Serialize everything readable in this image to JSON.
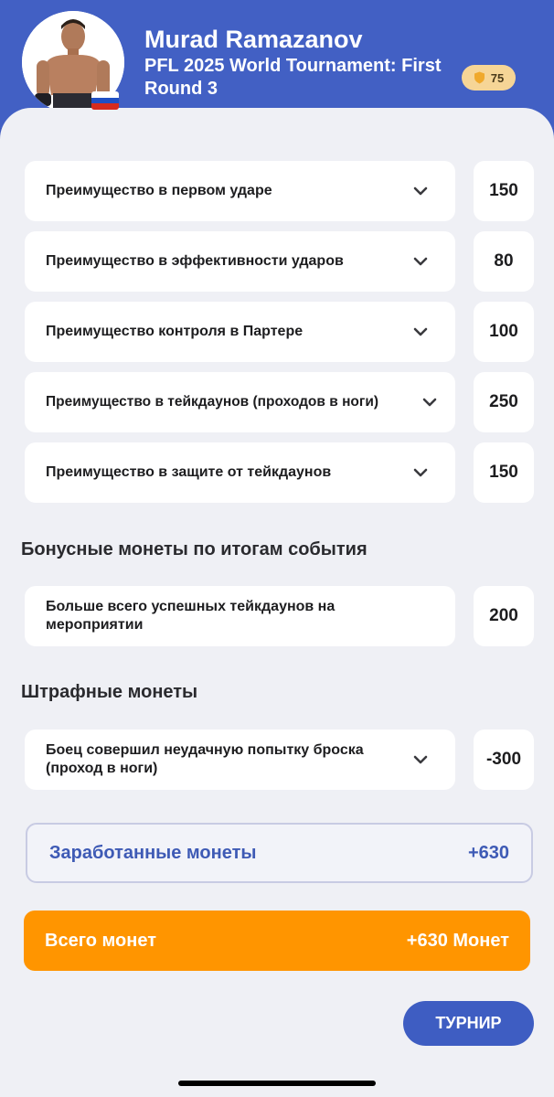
{
  "header": {
    "fighter_name": "Murad Ramazanov",
    "event_name": "PFL 2025 World Tournament: First Round 3",
    "coins": "75",
    "avatar_icon": "fighter-photo",
    "flag_icon": "russia-flag"
  },
  "advantages": [
    {
      "label": "Преимущество в первом ударе",
      "value": "150"
    },
    {
      "label": "Преимущество в эффективности ударов",
      "value": "80"
    },
    {
      "label": "Преимущество контроля в Партере",
      "value": "100"
    },
    {
      "label": "Преимущество в тейкдаунов (проходов в ноги)",
      "value": "250"
    },
    {
      "label": "Преимущество в защите от тейкдаунов",
      "value": "150"
    }
  ],
  "bonus": {
    "title": "Бонусные монеты по итогам события",
    "items": [
      {
        "label": "Больше всего успешных тейкдаунов на мероприятии",
        "value": "200"
      }
    ]
  },
  "penalty": {
    "title": "Штрафные монеты",
    "items": [
      {
        "label": "Боец совершил неудачную попытку броска (проход в ноги)",
        "value": "-300"
      }
    ]
  },
  "earned": {
    "label": "Заработанные монеты",
    "value": "+630"
  },
  "total": {
    "label": "Всего монет",
    "value": "+630 Монет"
  },
  "tournament_button": "ТУРНИР",
  "colors": {
    "header_blue": "#4260c4",
    "panel_bg": "#eff0f5",
    "accent_blue": "#3e5ab5",
    "orange": "#ff9500",
    "coin_badge": "#f6d596"
  }
}
